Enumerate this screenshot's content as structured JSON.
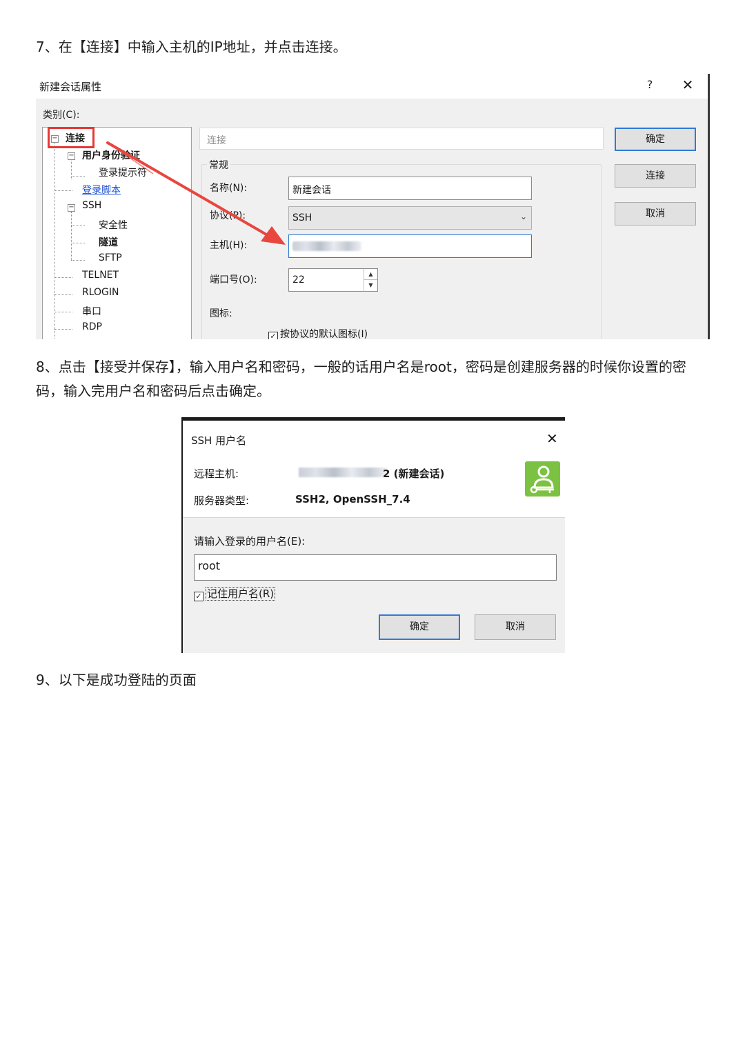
{
  "steps": {
    "step7": "7、在【连接】中输入主机的IP地址，并点击连接。",
    "step8": "8、点击【接受并保存】，输入用户名和密码，一般的话用户名是root，密码是创建服务器的时候你设置的密码，输入完用户名和密码后点击确定。",
    "step9": "9、以下是成功登陆的页面"
  },
  "session_dialog": {
    "title": "新建会话属性",
    "help": "?",
    "close": "✕",
    "category_label": "类别(C):",
    "tree": {
      "connection": "连接",
      "auth": "用户身份验证",
      "login_prompt": "登录提示符",
      "login_script": "登录脚本",
      "ssh": "SSH",
      "security": "安全性",
      "tunnel": "隧道",
      "sftp": "SFTP",
      "telnet": "TELNET",
      "rlogin": "RLOGIN",
      "serial": "串口",
      "rdp": "RDP"
    },
    "panel_title": "连接",
    "group_title": "常规",
    "name_label": "名称(N):",
    "name_value": "新建会话",
    "protocol_label": "协议(P):",
    "protocol_value": "SSH",
    "host_label": "主机(H):",
    "port_label": "端口号(O):",
    "port_value": "22",
    "icon_label": "图标:",
    "default_icon_checkbox": "按协议的默认图标(I)",
    "buttons": {
      "ok": "确定",
      "connect": "连接",
      "cancel": "取消"
    },
    "accent_color": "#2f7ad6",
    "highlight_color": "#e53935"
  },
  "ssh_dialog": {
    "title": "SSH 用户名",
    "close": "✕",
    "remote_host_label": "远程主机:",
    "remote_host_suffix": "2 (新建会话)",
    "server_type_label": "服务器类型:",
    "server_type_value": "SSH2, OpenSSH_7.4",
    "username_prompt": "请输入登录的用户名(E):",
    "username_value": "root",
    "remember_checkbox": "记住用户名(R)",
    "buttons": {
      "ok": "确定",
      "cancel": "取消"
    },
    "icon_color": "#7cc242"
  }
}
